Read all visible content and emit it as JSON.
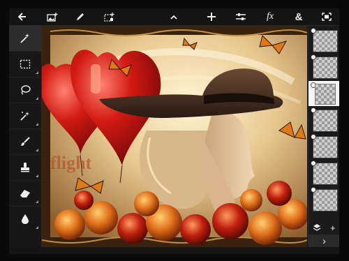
{
  "toolbar": {
    "icons": [
      "back-arrow-icon",
      "add-image-icon",
      "pencil-icon",
      "transform-selection-icon",
      "chevron-up-icon",
      "add-layer-icon",
      "adjustments-icon",
      "effects-icon",
      "blend-icon",
      "fullscreen-icon"
    ],
    "fx_label": "fx",
    "blend_label": "&"
  },
  "left_tools": {
    "items": [
      "magic-wand",
      "rectangle-select",
      "lasso",
      "smart-brush",
      "brush",
      "clone-stamp",
      "eraser",
      "blur"
    ],
    "active": "magic-wand"
  },
  "canvas": {
    "text_overlay": "flight"
  },
  "layers": {
    "count": 8,
    "selected_index": 2,
    "add_label": "+",
    "expand_label": "›"
  },
  "colors": {
    "background": "#0a0a0a",
    "toolbar": "#141414",
    "selected_layer": "#f4f4f4"
  }
}
